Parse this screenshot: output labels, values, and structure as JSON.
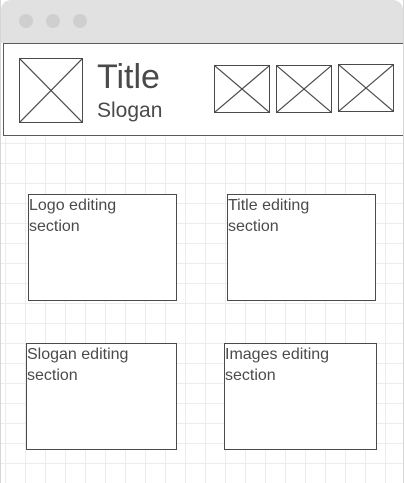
{
  "header": {
    "title": "Title",
    "slogan": "Slogan",
    "logo_placeholder": "image-placeholder",
    "image_placeholders": [
      "image-placeholder",
      "image-placeholder",
      "image-placeholder"
    ]
  },
  "sections": {
    "logo": "Logo editing\nsection",
    "title": "Title editing\nsection",
    "slogan": "Slogan editing\nsection",
    "images": "Images editing\nsection"
  },
  "colors": {
    "titlebar": "#e1e1e1",
    "window_dot": "#cfcfcf",
    "outline": "#4a4a4a",
    "grid_line": "#ececec"
  }
}
